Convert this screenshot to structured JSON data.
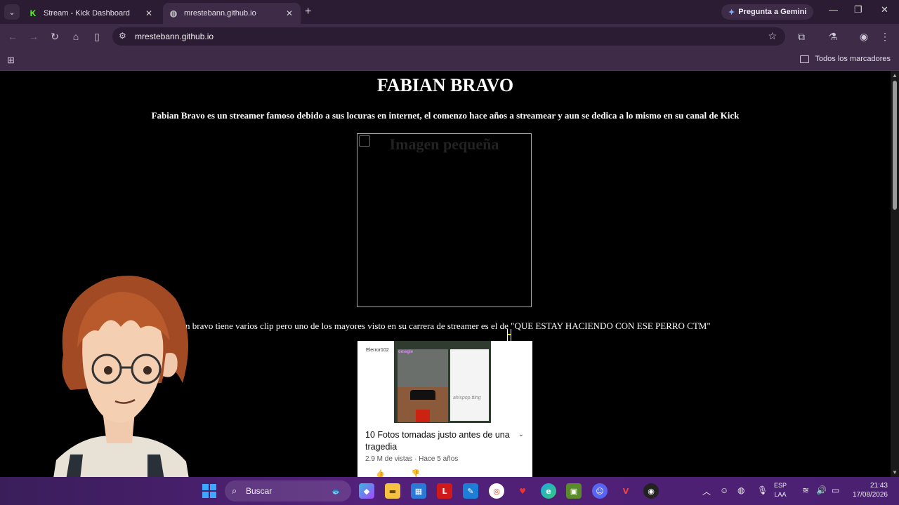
{
  "browser": {
    "tabs": [
      {
        "title": "Stream - Kick Dashboard",
        "favicon": "kick-icon",
        "active": false
      },
      {
        "title": "mrestebann.github.io",
        "favicon": "globe-icon",
        "active": true
      }
    ],
    "gemini_label": "Pregunta a Gemini",
    "url": "mrestebann.github.io",
    "all_bookmarks_label": "Todos los marcadores"
  },
  "page": {
    "title": "FABIAN BRAVO",
    "intro": "Fabian Bravo es un streamer famoso debido a sus locuras en internet, el comenzo hace años a streamear y aun se dedica a lo mismo en su canal de Kick",
    "image_alt": "Imagen pequeña",
    "clip_text": "n bravo tiene varios clip pero uno de los mayores visto en su carrera de streamer es el de \"QUE ESTAY HACIENDO CON ESE PERRO CTM\"",
    "video": {
      "channel": "Elerror102",
      "site_logo": "omegle",
      "watermark": "ahispop.tting",
      "title": "10 Fotos tomadas justo antes de una tragedia",
      "meta": "2.9 M de vistas · Hace 5 años"
    }
  },
  "taskbar": {
    "search_placeholder": "Buscar",
    "language": "ESP",
    "keyboard": "LAA",
    "time": "21:43",
    "date": "17/08/2026"
  },
  "colors": {
    "chrome_frame": "#2b1c33",
    "toolbar": "#3d2b48",
    "kick_green": "#53fc18",
    "page_bg": "#000000"
  }
}
